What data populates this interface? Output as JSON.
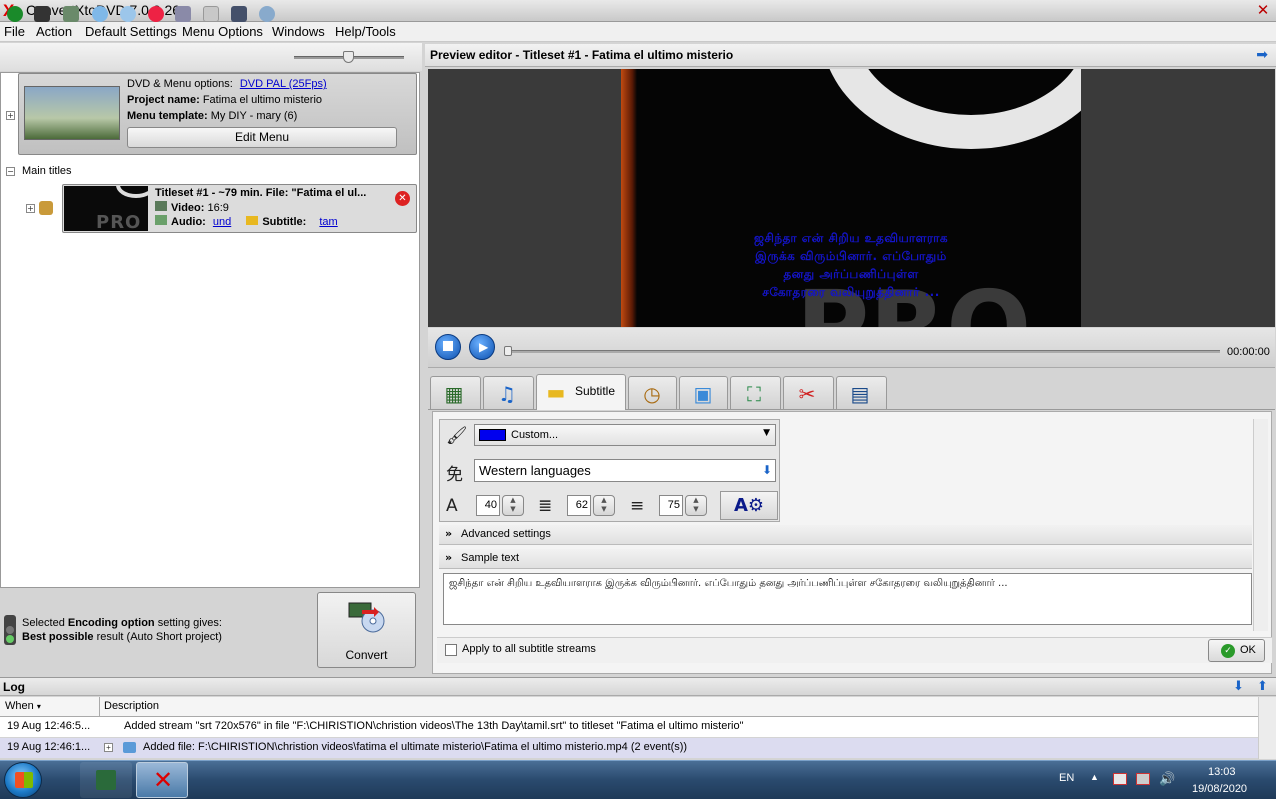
{
  "window": {
    "title": "ConvertXtoDVD 7.0.0.26",
    "logo": "X"
  },
  "menu": [
    "File",
    "Action",
    "Default Settings",
    "Menu Options",
    "Windows",
    "Help/Tools"
  ],
  "project": {
    "dvd_menu_options_label": "DVD & Menu options:",
    "dvd_menu_options_value": "DVD PAL (25Fps)",
    "project_name_label": "Project name:",
    "project_name_value": "Fatima el ultimo misterio",
    "menu_template_label": "Menu template:",
    "menu_template_value": "My  DIY - mary (6)",
    "edit_menu_label": "Edit Menu"
  },
  "tree": {
    "main_titles_label": "Main titles"
  },
  "titleset": {
    "heading": "Titleset #1 - ~79 min. File: \"Fatima el ul...",
    "video_label": "Video:",
    "video_value": "16:9",
    "audio_label": "Audio:",
    "audio_value": "und",
    "subtitle_label": "Subtitle:",
    "subtitle_value": "tam",
    "thumb_text": "PRO"
  },
  "status": {
    "line1_a": "Selected ",
    "line1_b": "Encoding option",
    "line1_c": " setting gives:",
    "line2_a": "Best possible",
    "line2_b": " result (Auto Short project)"
  },
  "convert_label": "Convert",
  "preview": {
    "header": "Preview editor - Titleset #1 - Fatima el ultimo misterio",
    "frame_text": "PRO",
    "subtitle_lines": [
      "ஜசிந்தா என் சிறிய உதவியாளராக",
      "இருக்க விரும்பினார். எப்போதும்",
      "தனது அர்ப்பணிப்புள்ள",
      "சகோதரரை வலியுறுத்தினார் ..."
    ],
    "time": "00:00:00"
  },
  "tabs": {
    "subtitle_label": "Subtitle",
    "active": "Subtitle"
  },
  "subtitle_settings": {
    "color_value": "Custom...",
    "color_hex": "#0000ee",
    "charset_value": "Western languages",
    "font_size": "40",
    "vertical_pos": "62",
    "line_spacing": "75",
    "advanced_label": "Advanced settings",
    "sample_label": "Sample text",
    "sample_text": "ஜசிந்தா என் சிறிய உதவியாளராக இருக்க விரும்பினார். எப்போதும் தனது அர்ப்பணிப்புள்ள சகோதரரை வலியுறுத்தினார் ...",
    "apply_all_label": "Apply to all subtitle streams",
    "ok_label": "OK"
  },
  "log": {
    "title": "Log",
    "col_when": "When",
    "col_description": "Description",
    "rows": [
      {
        "when": "19 Aug 12:46:5...",
        "description": "Added stream \"srt 720x576\" in file \"F:\\CHIRISTION\\christion videos\\The 13th Day\\tamil.srt\" to titleset \"Fatima el ultimo misterio\""
      },
      {
        "when": "19 Aug 12:46:1...",
        "description": "Added file: F:\\CHIRISTION\\christion videos\\fatima el ultimate misterio\\Fatima el ultimo misterio.mp4 (2 event(s))"
      }
    ]
  },
  "taskbar": {
    "lang": "EN",
    "time": "13:03",
    "date": "19/08/2020"
  }
}
